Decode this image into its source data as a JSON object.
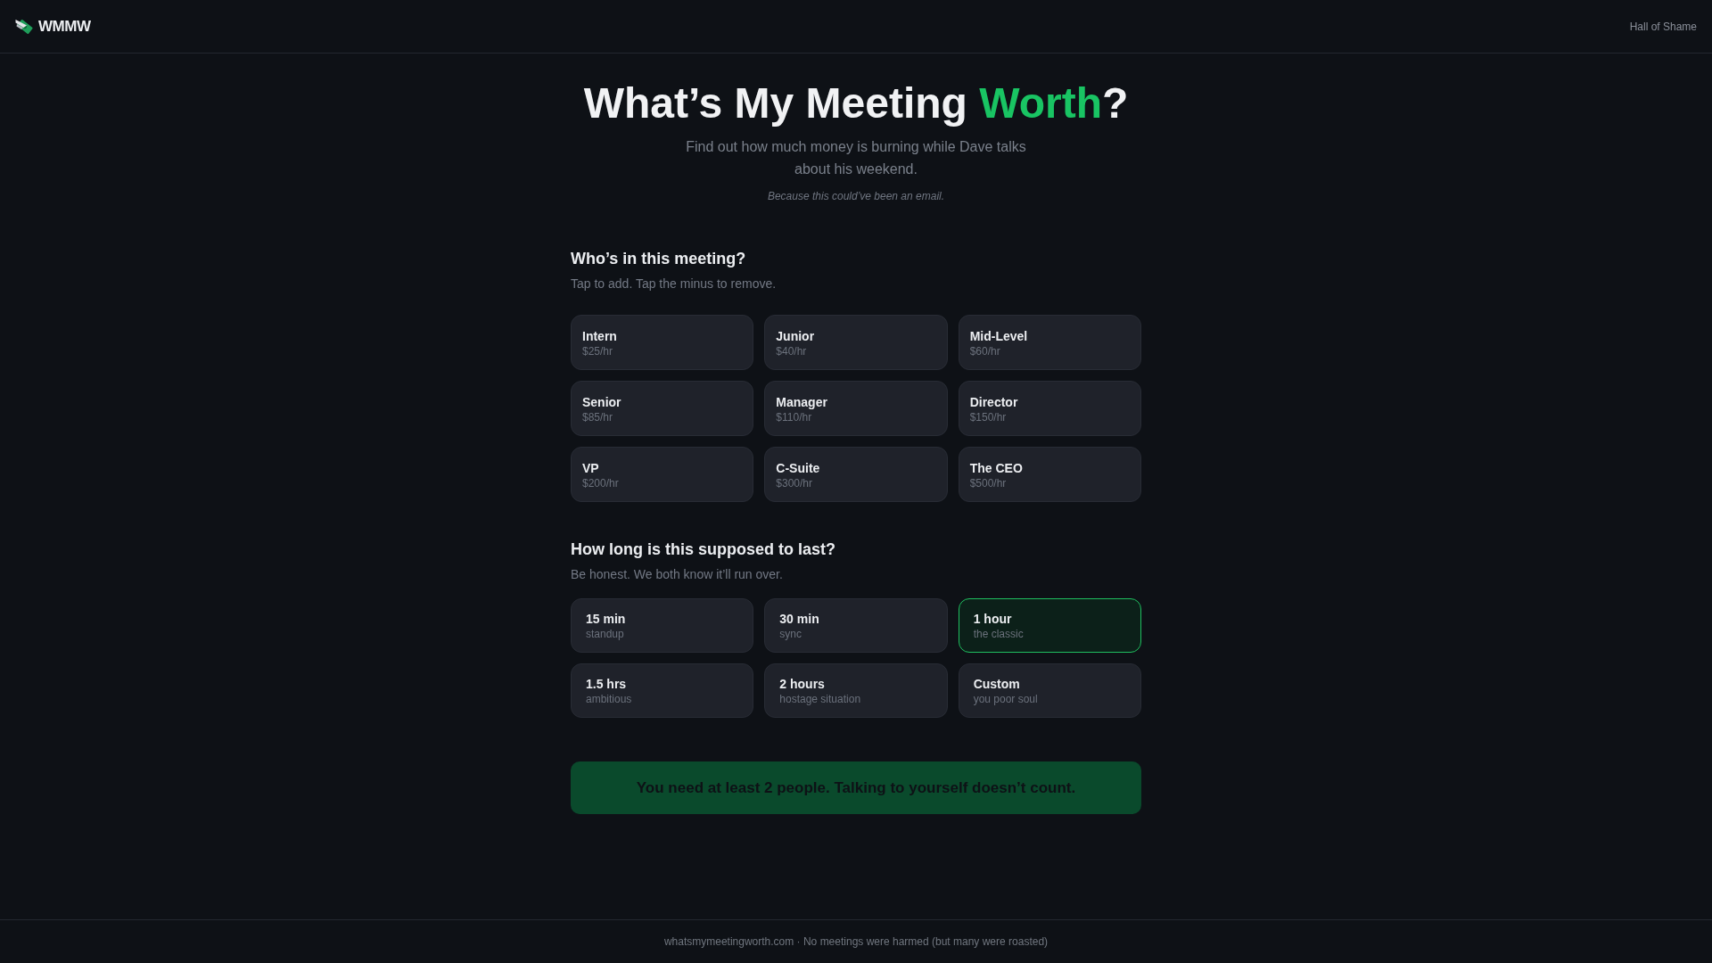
{
  "header": {
    "logo_text": "WMMW",
    "nav_link": "Hall of Shame"
  },
  "hero": {
    "title": {
      "before": "What’s My Meeting ",
      "highlight": "Worth",
      "after": "?"
    },
    "subtitle": "Find out how much money is burning while Dave talks about his weekend.",
    "tagline": "Because this could’ve been an email."
  },
  "attendees": {
    "heading": "Who’s in this meeting?",
    "hint": "Tap to add. Tap the minus to remove.",
    "roles": [
      {
        "name": "Intern",
        "rate": "$25/hr"
      },
      {
        "name": "Junior",
        "rate": "$40/hr"
      },
      {
        "name": "Mid-Level",
        "rate": "$60/hr"
      },
      {
        "name": "Senior",
        "rate": "$85/hr"
      },
      {
        "name": "Manager",
        "rate": "$110/hr"
      },
      {
        "name": "Director",
        "rate": "$150/hr"
      },
      {
        "name": "VP",
        "rate": "$200/hr"
      },
      {
        "name": "C-Suite",
        "rate": "$300/hr"
      },
      {
        "name": "The CEO",
        "rate": "$500/hr"
      }
    ]
  },
  "duration": {
    "heading": "How long is this supposed to last?",
    "hint": "Be honest. We both know it’ll run over.",
    "options": [
      {
        "label": "15 min",
        "note": "standup",
        "selected": false
      },
      {
        "label": "30 min",
        "note": "sync",
        "selected": false
      },
      {
        "label": "1 hour",
        "note": "the classic",
        "selected": true
      },
      {
        "label": "1.5 hrs",
        "note": "ambitious",
        "selected": false
      },
      {
        "label": "2 hours",
        "note": "hostage situation",
        "selected": false
      },
      {
        "label": "Custom",
        "note": "you poor soul",
        "selected": false
      }
    ]
  },
  "submit_button": {
    "label": "You need at least 2 people. Talking to yourself doesn’t count.",
    "disabled": true
  },
  "footer": {
    "text": "whatsmymeetingworth.com · No meetings were harmed (but many were roasted)"
  }
}
